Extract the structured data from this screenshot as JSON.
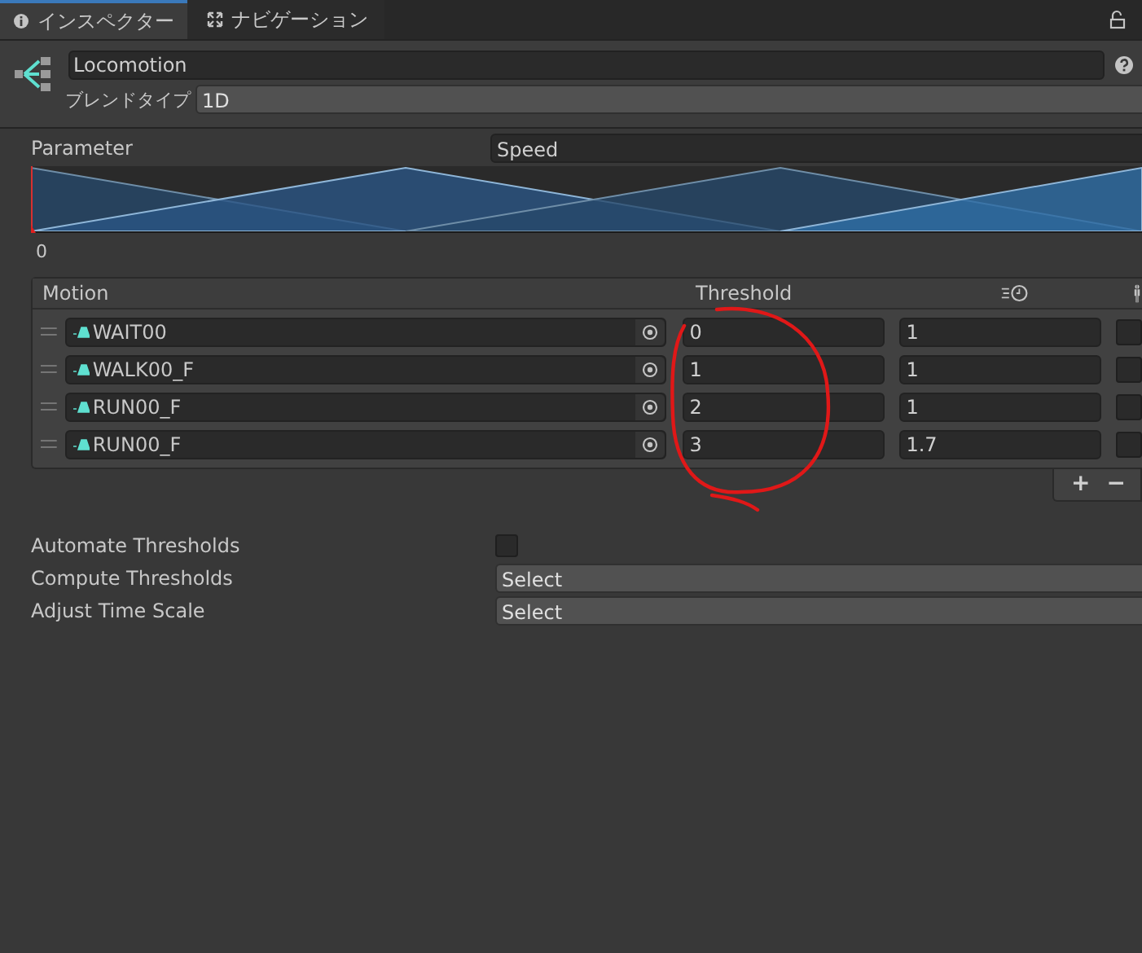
{
  "tabs": [
    {
      "label": "インスペクター",
      "selected": true
    },
    {
      "label": "ナビゲーション",
      "selected": false
    }
  ],
  "object": {
    "name": "Locomotion",
    "blend_type_label": "ブレンドタイプ",
    "blend_type": "1D"
  },
  "parameter": {
    "label": "Parameter",
    "value": "Speed",
    "axis_label": "0"
  },
  "motions": {
    "columns": [
      "Motion",
      "Threshold"
    ],
    "rows": [
      {
        "clip": "WAIT00",
        "threshold": "0",
        "time_scale": "1",
        "mirrored": false
      },
      {
        "clip": "WALK00_F",
        "threshold": "1",
        "time_scale": "1",
        "mirrored": false
      },
      {
        "clip": "RUN00_F",
        "threshold": "2",
        "time_scale": "1",
        "mirrored": false
      },
      {
        "clip": "RUN00_F",
        "threshold": "3",
        "time_scale": "1.7",
        "mirrored": false
      }
    ],
    "buttons": [
      "+",
      "−"
    ]
  },
  "settings": [
    {
      "kind": "checkbox",
      "label": "Automate Thresholds",
      "checked": false
    },
    {
      "kind": "dropdown",
      "label": "Compute Thresholds",
      "value": "Select"
    },
    {
      "kind": "dropdown",
      "label": "Adjust Time Scale",
      "value": "Select"
    }
  ]
}
